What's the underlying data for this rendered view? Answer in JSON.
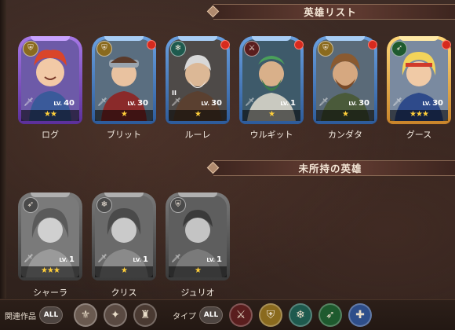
{
  "sections": {
    "owned_title": "英雄リスト",
    "unowned_title": "未所持の英雄"
  },
  "owned_heroes": [
    {
      "name": "ログ",
      "level": "40",
      "lv_prefix": "LV.",
      "stars": "★★",
      "rarity": "purple",
      "type_icon": "shield-crest",
      "new": false
    },
    {
      "name": "ブリット",
      "level": "30",
      "lv_prefix": "LV.",
      "stars": "★",
      "rarity": "blue",
      "type_icon": "shield-crest",
      "new": true
    },
    {
      "name": "ルーレ",
      "level": "30",
      "lv_prefix": "LV.",
      "stars": "★",
      "rarity": "blue",
      "type_icon": "snowflake",
      "new": true
    },
    {
      "name": "ウルギット",
      "level": "1",
      "lv_prefix": "LV.",
      "stars": "★",
      "rarity": "blue",
      "type_icon": "sword",
      "new": true
    },
    {
      "name": "カンダタ",
      "level": "30",
      "lv_prefix": "LV.",
      "stars": "★",
      "rarity": "blue",
      "type_icon": "shield-crest",
      "new": true
    },
    {
      "name": "グース",
      "level": "30",
      "lv_prefix": "LV.",
      "stars": "★★★",
      "rarity": "gold",
      "type_icon": "bow",
      "new": true
    }
  ],
  "unowned_heroes": [
    {
      "name": "シャーラ",
      "level": "1",
      "lv_prefix": "LV.",
      "stars": "★★★",
      "rarity": "grey",
      "type_icon": "bow"
    },
    {
      "name": "クリス",
      "level": "1",
      "lv_prefix": "LV.",
      "stars": "★",
      "rarity": "grey",
      "type_icon": "snowflake"
    },
    {
      "name": "ジュリオ",
      "level": "1",
      "lv_prefix": "LV.",
      "stars": "★",
      "rarity": "grey",
      "type_icon": "shield-crest"
    }
  ],
  "bottom_bar": {
    "work_label": "関連作品",
    "work_all": "ALL",
    "type_label": "タイプ",
    "type_all": "ALL",
    "type_filters": [
      {
        "icon": "sword",
        "color": "#5a1e1e"
      },
      {
        "icon": "shield-crest",
        "color": "#8a6a1e"
      },
      {
        "icon": "snowflake",
        "color": "#1e5a4e"
      },
      {
        "icon": "bow",
        "color": "#1e5a2e"
      },
      {
        "icon": "cross-star",
        "color": "#2e4e8a"
      }
    ]
  },
  "colors": {
    "star": "#ffcf3a",
    "new_dot": "#d62a1e"
  }
}
